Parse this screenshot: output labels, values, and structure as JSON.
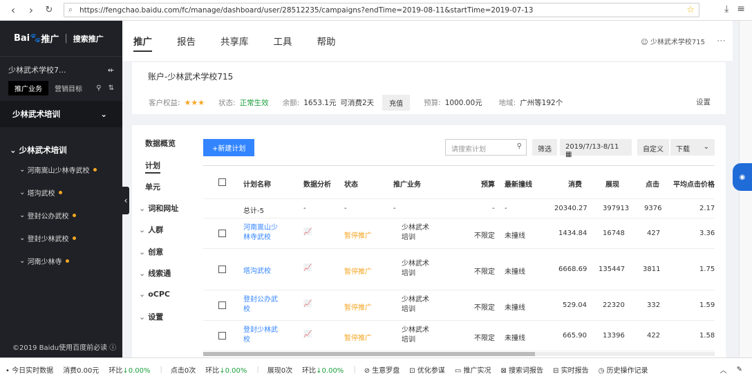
{
  "browser": {
    "url": "https://fengchao.baidu.com/fc/manage/dashboard/user/28512235/campaigns?endTime=2019-08-11&startTime=2019-07-13"
  },
  "sidebar": {
    "brand": "Bai",
    "brand2": "推广",
    "product": "搜索推广",
    "account_short": "少林武术学校7...",
    "tabs": [
      "推广业务",
      "营销目标"
    ],
    "group": "少林武术培训",
    "subgroup": "少林武术培训",
    "items": [
      "河南嵩山少林寺武校",
      "塔沟武校",
      "登封公办武校",
      "登封少林武校",
      "河南少林寺"
    ],
    "footer": "©2019 Baidu使用百度前必读"
  },
  "topnav": {
    "menu": [
      "推广",
      "报告",
      "共享库",
      "工具",
      "帮助"
    ],
    "user": "少林武术学校715"
  },
  "account": {
    "title": "账户-少林武术学校715",
    "rights_label": "客户权益:",
    "status_label": "状态:",
    "status": "正常生效",
    "balance_label": "余额:",
    "balance": "1653.1元",
    "consumable": "可消费2天",
    "recharge": "充值",
    "budget_label": "预算:",
    "budget": "1000.00元",
    "region_label": "地域:",
    "region": "广州等192个",
    "settings": "设置"
  },
  "leftnav": {
    "items": [
      "数据概览",
      "计划",
      "单元",
      "词和网址",
      "人群",
      "创意",
      "线索通",
      "oCPC",
      "设置"
    ]
  },
  "toolbar": {
    "new_plan": "+新建计划",
    "search_placeholder": "请搜索计划",
    "filter": "筛选",
    "daterange": "2019/7/13-8/11",
    "custom": "自定义",
    "download": "下载"
  },
  "table": {
    "headers": [
      "计划名称",
      "数据分析",
      "状态",
      "推广业务",
      "预算",
      "最新撞线",
      "消费",
      "展现",
      "点击",
      "平均点击价格"
    ],
    "total": {
      "name": "总计-5",
      "analysis": "-",
      "status": "-",
      "business": "-",
      "budget": "-",
      "line": "-",
      "cost": "20340.27",
      "impressions": "397913",
      "clicks": "9376",
      "cpc": "2.17"
    },
    "rows": [
      {
        "name1": "河南嵩山少",
        "name2": "林寺武校",
        "status": "暂停推广",
        "biz1": "少林武术",
        "biz2": "培训",
        "budget": "不限定",
        "line": "未撞线",
        "cost": "1434.84",
        "impressions": "16748",
        "clicks": "427",
        "cpc": "3.36"
      },
      {
        "name1": "塔沟武校",
        "name2": "",
        "status": "暂停推广",
        "biz1": "少林武术",
        "biz2": "培训",
        "budget": "不限定",
        "line": "未撞线",
        "cost": "6668.69",
        "impressions": "135447",
        "clicks": "3811",
        "cpc": "1.75"
      },
      {
        "name1": "登封公办武",
        "name2": "校",
        "status": "暂停推广",
        "biz1": "少林武术",
        "biz2": "培训",
        "budget": "不限定",
        "line": "未撞线",
        "cost": "529.04",
        "impressions": "22320",
        "clicks": "332",
        "cpc": "1.59"
      },
      {
        "name1": "登封少林武",
        "name2": "校",
        "status": "暂停推广",
        "biz1": "少林武术",
        "biz2": "培训",
        "budget": "不限定",
        "line": "未撞线",
        "cost": "665.90",
        "impressions": "13396",
        "clicks": "422",
        "cpc": "1.58"
      }
    ]
  },
  "statusbar": {
    "realtime": "今日实时数据",
    "cost": "消费0.00元",
    "ratio1": "环比",
    "ratio1v": "↓0.00%",
    "clicks": "点击0次",
    "ratio2": "环比",
    "ratio2v": "↓0.00%",
    "impr": "展现0次",
    "ratio3": "环比",
    "ratio3v": "↓0.00%",
    "tools": [
      "生意罗盘",
      "优化参谋",
      "推广实况",
      "搜索词报告",
      "实时报告",
      "历史操作记录"
    ]
  }
}
